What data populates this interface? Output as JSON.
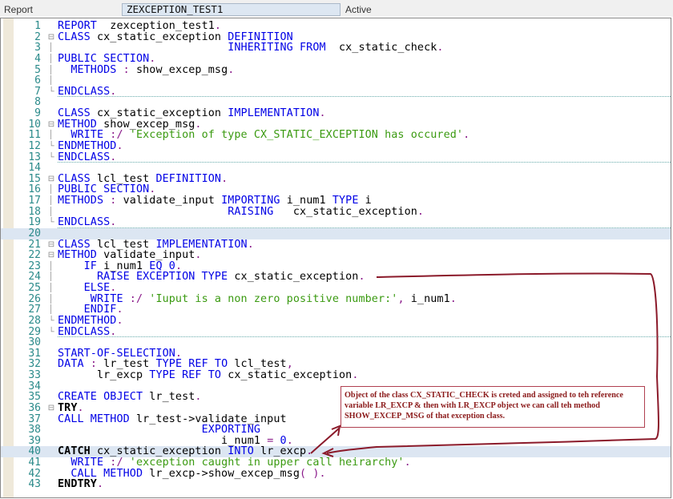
{
  "header": {
    "type_label": "Report",
    "program_name": "ZEXCEPTION_TEST1",
    "status": "Active"
  },
  "annotation": {
    "text": "Object of the class CX_STATIC_CHECK is creted and assigned to teh reference variable LR_EXCP & then with LR_EXCP object we can call teh method SHOW_EXCEP_MSG of that exception class."
  },
  "colors": {
    "keyword": "#0000e6",
    "string": "#3a9a10",
    "line_number": "#2a8a8a",
    "annotation": "#8b1a1a",
    "highlight": "#dce6f2"
  },
  "lines": [
    [
      [
        "k",
        "REPORT"
      ],
      [
        "i",
        "  zexception_test1"
      ],
      [
        "p",
        "."
      ]
    ],
    [
      [
        "k",
        "CLASS"
      ],
      [
        "i",
        " cx_static_exception "
      ],
      [
        "k",
        "DEFINITION"
      ]
    ],
    [
      [
        "i",
        "                          "
      ],
      [
        "k",
        "INHERITING FROM"
      ],
      [
        "i",
        "  cx_static_check"
      ],
      [
        "p",
        "."
      ]
    ],
    [
      [
        "k",
        "PUBLIC SECTION"
      ],
      [
        "p",
        "."
      ]
    ],
    [
      [
        "k",
        "  METHODS"
      ],
      [
        "p",
        " : "
      ],
      [
        "i",
        "show_excep_msg"
      ],
      [
        "p",
        "."
      ]
    ],
    [],
    [
      [
        "k",
        "ENDCLASS"
      ],
      [
        "p",
        "."
      ]
    ],
    [],
    [
      [
        "k",
        "CLASS"
      ],
      [
        "i",
        " cx_static_exception "
      ],
      [
        "k",
        "IMPLEMENTATION"
      ],
      [
        "p",
        "."
      ]
    ],
    [
      [
        "k",
        "METHOD"
      ],
      [
        "i",
        " show_excep_msg"
      ],
      [
        "p",
        "."
      ]
    ],
    [
      [
        "k",
        "  WRITE"
      ],
      [
        "p",
        " :/ "
      ],
      [
        "s",
        "'Exception of type CX_STATIC_EXCEPTION has occured'"
      ],
      [
        "p",
        "."
      ]
    ],
    [
      [
        "k",
        "ENDMETHOD"
      ],
      [
        "p",
        "."
      ]
    ],
    [
      [
        "k",
        "ENDCLASS"
      ],
      [
        "p",
        "."
      ]
    ],
    [],
    [
      [
        "k",
        "CLASS"
      ],
      [
        "i",
        " lcl_test "
      ],
      [
        "k",
        "DEFINITION"
      ],
      [
        "p",
        "."
      ]
    ],
    [
      [
        "k",
        "PUBLIC SECTION"
      ],
      [
        "p",
        "."
      ]
    ],
    [
      [
        "k",
        "METHODS"
      ],
      [
        "p",
        " : "
      ],
      [
        "i",
        "validate_input "
      ],
      [
        "k",
        "IMPORTING"
      ],
      [
        "i",
        " i_num1 "
      ],
      [
        "k",
        "TYPE"
      ],
      [
        "i",
        " i"
      ]
    ],
    [
      [
        "i",
        "                          "
      ],
      [
        "k",
        "RAISING"
      ],
      [
        "i",
        "   cx_static_exception"
      ],
      [
        "p",
        "."
      ]
    ],
    [
      [
        "k",
        "ENDCLASS"
      ],
      [
        "p",
        "."
      ]
    ],
    [],
    [
      [
        "k",
        "CLASS"
      ],
      [
        "i",
        " lcl_test "
      ],
      [
        "k",
        "IMPLEMENTATION"
      ],
      [
        "p",
        "."
      ]
    ],
    [
      [
        "k",
        "METHOD"
      ],
      [
        "i",
        " validate_input"
      ],
      [
        "p",
        "."
      ]
    ],
    [
      [
        "k",
        "    IF"
      ],
      [
        "i",
        " i_num1 "
      ],
      [
        "k",
        "EQ"
      ],
      [
        "n",
        " 0"
      ],
      [
        "p",
        "."
      ]
    ],
    [
      [
        "k",
        "      RAISE EXCEPTION TYPE"
      ],
      [
        "i",
        " cx_static_exception"
      ],
      [
        "p",
        "."
      ]
    ],
    [
      [
        "k",
        "    ELSE"
      ],
      [
        "p",
        "."
      ]
    ],
    [
      [
        "k",
        "     WRITE"
      ],
      [
        "p",
        " :/ "
      ],
      [
        "s",
        "'Iuput is a non zero positive number:'"
      ],
      [
        "p",
        ", "
      ],
      [
        "i",
        "i_num1"
      ],
      [
        "p",
        "."
      ]
    ],
    [
      [
        "k",
        "    ENDIF"
      ],
      [
        "p",
        "."
      ]
    ],
    [
      [
        "k",
        "ENDMETHOD"
      ],
      [
        "p",
        "."
      ]
    ],
    [
      [
        "k",
        "ENDCLASS"
      ],
      [
        "p",
        "."
      ]
    ],
    [],
    [
      [
        "k",
        "START-OF-SELECTION"
      ],
      [
        "p",
        "."
      ]
    ],
    [
      [
        "k",
        "DATA"
      ],
      [
        "p",
        " : "
      ],
      [
        "i",
        "lr_test "
      ],
      [
        "k",
        "TYPE REF TO"
      ],
      [
        "i",
        " lcl_test"
      ],
      [
        "p",
        ","
      ]
    ],
    [
      [
        "i",
        "      lr_excp "
      ],
      [
        "k",
        "TYPE REF TO"
      ],
      [
        "i",
        " cx_static_exception"
      ],
      [
        "p",
        "."
      ]
    ],
    [],
    [
      [
        "k",
        "CREATE OBJECT"
      ],
      [
        "i",
        " lr_test"
      ],
      [
        "p",
        "."
      ]
    ],
    [
      [
        "b",
        "TRY"
      ],
      [
        "p",
        "."
      ]
    ],
    [
      [
        "k",
        "CALL METHOD"
      ],
      [
        "i",
        " lr_test->validate_input"
      ]
    ],
    [
      [
        "i",
        "                      "
      ],
      [
        "k",
        "EXPORTING"
      ]
    ],
    [
      [
        "i",
        "                         i_num1 "
      ],
      [
        "p",
        "= "
      ],
      [
        "n",
        "0"
      ],
      [
        "p",
        "."
      ]
    ],
    [
      [
        "b",
        "CATCH"
      ],
      [
        "i",
        " cx_static_exception "
      ],
      [
        "k",
        "INTO"
      ],
      [
        "i",
        " lr_excp"
      ],
      [
        "p",
        "."
      ]
    ],
    [
      [
        "k",
        "  WRITE"
      ],
      [
        "p",
        " :/ "
      ],
      [
        "s",
        "'exception caught in upper call heirarchy'"
      ],
      [
        "p",
        "."
      ]
    ],
    [
      [
        "k",
        "  CALL METHOD"
      ],
      [
        "i",
        " lr_excp->show_excep_msg"
      ],
      [
        "p",
        "( )."
      ]
    ],
    [
      [
        "b",
        "ENDTRY"
      ],
      [
        "p",
        "."
      ]
    ]
  ]
}
